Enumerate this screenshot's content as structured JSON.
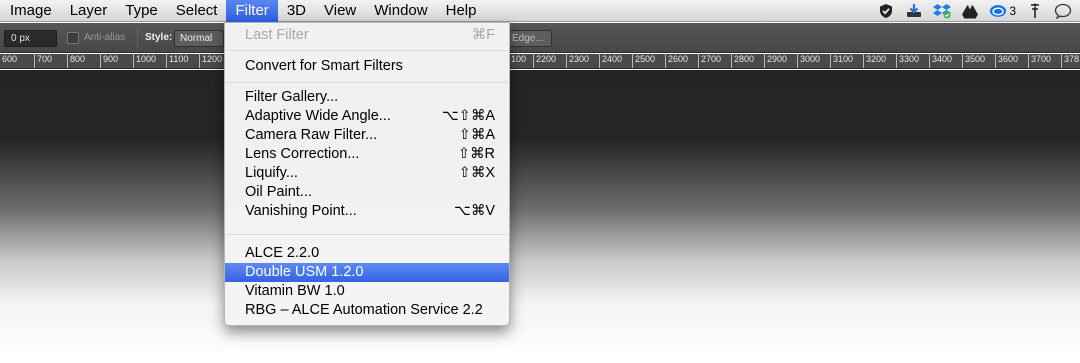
{
  "menubar": {
    "items": [
      "Image",
      "Layer",
      "Type",
      "Select",
      "Filter",
      "3D",
      "View",
      "Window",
      "Help"
    ],
    "active_index": 4,
    "status": {
      "icons": [
        "shield-check-icon",
        "download-arrow-icon",
        "dropbox-icon",
        "drive-icon",
        "creative-cloud-icon",
        "network-antenna-icon",
        "chat-bubble-icon"
      ],
      "cc_count": "3"
    }
  },
  "options": {
    "feather_value": "0 px",
    "antialias_label": "Anti-alias",
    "style_label": "Style:",
    "style_value": "Normal",
    "refine_edge_label": "Edge..."
  },
  "ruler": {
    "left_labels": [
      "600",
      "700",
      "800",
      "900",
      "1000",
      "1100",
      "1200"
    ],
    "right_labels": [
      "100",
      "2200",
      "2300",
      "2400",
      "2500",
      "2600",
      "2700",
      "2800",
      "2900",
      "3000",
      "3100",
      "3200",
      "3300",
      "3400",
      "3500",
      "3600",
      "3700",
      "378"
    ]
  },
  "filter_menu": {
    "last_filter": {
      "label": "Last Filter",
      "shortcut": "⌘F"
    },
    "smart_filters": "Convert for Smart Filters",
    "filters": [
      {
        "label": "Filter Gallery...",
        "shortcut": ""
      },
      {
        "label": "Adaptive Wide Angle...",
        "shortcut": "⌥⇧⌘A"
      },
      {
        "label": "Camera Raw Filter...",
        "shortcut": "⇧⌘A"
      },
      {
        "label": "Lens Correction...",
        "shortcut": "⇧⌘R"
      },
      {
        "label": "Liquify...",
        "shortcut": "⇧⌘X"
      },
      {
        "label": "Oil Paint...",
        "shortcut": ""
      },
      {
        "label": "Vanishing Point...",
        "shortcut": "⌥⌘V"
      }
    ],
    "plugins": [
      {
        "label": "ALCE 2.2.0"
      },
      {
        "label": "Double USM 1.2.0",
        "highlighted": true
      },
      {
        "label": "Vitamin BW 1.0"
      },
      {
        "label": "RBG – ALCE Automation Service 2.2"
      }
    ]
  }
}
